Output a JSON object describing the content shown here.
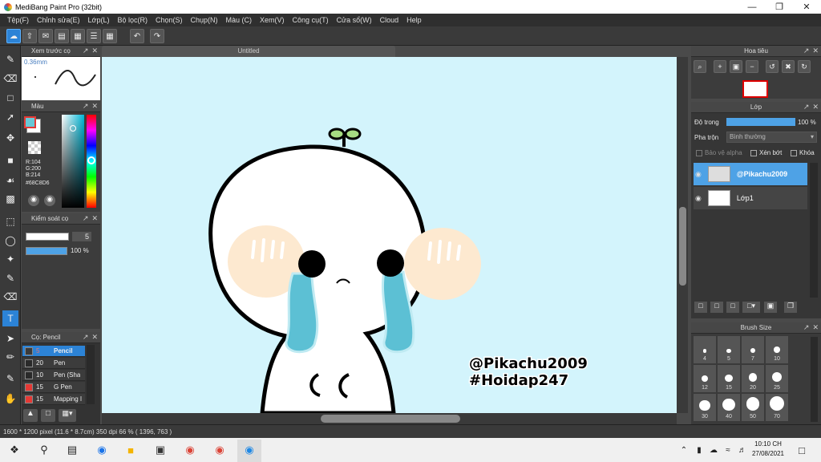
{
  "window": {
    "title": "MediBang Paint Pro (32bit)"
  },
  "menu": [
    "Tệp(F)",
    "Chỉnh sửa(E)",
    "Lớp(L)",
    "Bộ lọc(R)",
    "Chọn(S)",
    "Chụp(N)",
    "Màu (C)",
    "Xem(V)",
    "Công cụ(T)",
    "Cửa sổ(W)",
    "Cloud",
    "Help"
  ],
  "document": {
    "tab_title": "Untitled"
  },
  "brush_preview": {
    "title": "Xem trước cọ",
    "size": "0.36mm"
  },
  "color_panel": {
    "title": "Màu",
    "r": "R:104",
    "g": "G:200",
    "b": "B:214",
    "hex": "#68C8D6",
    "fg_color": "#68C8D6"
  },
  "brush_control": {
    "title": "Kiểm soát cọ",
    "size_value": "5",
    "opacity_value": "100 %",
    "opacity_fraction": 1.0
  },
  "brush_list": {
    "title": "Cọ: Pencil",
    "items": [
      {
        "size": "5",
        "name": "Pencil",
        "color": "#3a3a3a",
        "selected": true
      },
      {
        "size": "20",
        "name": "Pen",
        "color": "#2a2a2a",
        "selected": false
      },
      {
        "size": "10",
        "name": "Pen (Sha",
        "color": "#2a2a2a",
        "selected": false
      },
      {
        "size": "15",
        "name": "G Pen",
        "color": "#e53935",
        "selected": false
      },
      {
        "size": "15",
        "name": "Mapping I",
        "color": "#e53935",
        "selected": false
      }
    ]
  },
  "navigator": {
    "title": "Hoa tiêu"
  },
  "layer_panel": {
    "title": "Lớp",
    "opacity_label": "Độ trong",
    "opacity_value": "100 %",
    "opacity_fraction": 1.0,
    "blend_label": "Pha trộn",
    "blend_value": "Bình thường",
    "protect_alpha": "Bảo vệ alpha",
    "clipping": "Xén bớt",
    "lock": "Khóa",
    "layers": [
      {
        "name": "@Pikachu2009",
        "selected": true
      },
      {
        "name": "Lớp1",
        "selected": false
      }
    ]
  },
  "brush_size": {
    "title": "Brush Size",
    "sizes": [
      "4",
      "5",
      "7",
      "10",
      "12",
      "15",
      "20",
      "25",
      "30",
      "40",
      "50",
      "70"
    ]
  },
  "canvas_text": {
    "line1": "@Pikachu2009",
    "line2": "#Hoidap247"
  },
  "statusbar": {
    "text": "1600 * 1200 pixel   (11.6 * 8.7cm)   350 dpi   66 %   ( 1396, 763 )"
  },
  "taskbar": {
    "time": "10:10 CH",
    "date": "27/08/2021"
  },
  "colors": {
    "accent": "#2c83d6",
    "canvas_bg": "#d3f4fc",
    "tear": "#5cc0d4",
    "blush": "#fde9d0",
    "sprout": "#a6dc82"
  }
}
